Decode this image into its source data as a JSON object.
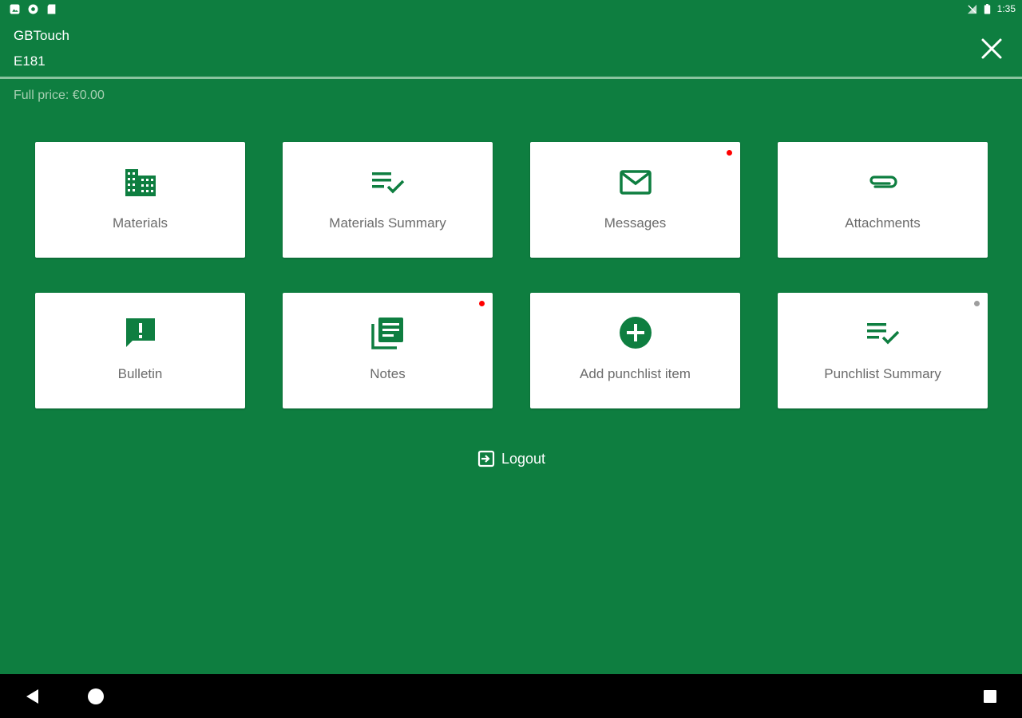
{
  "status_bar": {
    "time": "1:35",
    "left_icons": [
      "photo-icon",
      "settings-icon",
      "sd-card-icon"
    ],
    "right_icons": [
      "signal-icon",
      "battery-icon"
    ]
  },
  "header": {
    "title": "GBTouch",
    "subtitle": "E181",
    "close_icon": "close-icon"
  },
  "full_price": "Full price: €0.00",
  "tiles": [
    {
      "label": "Materials",
      "icon": "building-icon",
      "dot": null
    },
    {
      "label": "Materials Summary",
      "icon": "checklist-icon",
      "dot": null
    },
    {
      "label": "Messages",
      "icon": "mail-icon",
      "dot": "#ff0000"
    },
    {
      "label": "Attachments",
      "icon": "paperclip-icon",
      "dot": null
    },
    {
      "label": "Bulletin",
      "icon": "alert-message-icon",
      "dot": null
    },
    {
      "label": "Notes",
      "icon": "notes-icon",
      "dot": "#ff0000"
    },
    {
      "label": "Add punchlist item",
      "icon": "add-circle-icon",
      "dot": null
    },
    {
      "label": "Punchlist Summary",
      "icon": "checklist-icon",
      "dot": "#9e9e9e"
    }
  ],
  "logout": {
    "label": "Logout",
    "icon": "logout-icon"
  },
  "nav_bar": {
    "back": "back-icon",
    "home": "home-icon",
    "recents": "recents-icon"
  },
  "colors": {
    "background": "#0e7e40",
    "accent": "#0e7e40",
    "tile": "#ffffff",
    "label": "#6b6b6b",
    "price_text": "#a6cfb2"
  }
}
